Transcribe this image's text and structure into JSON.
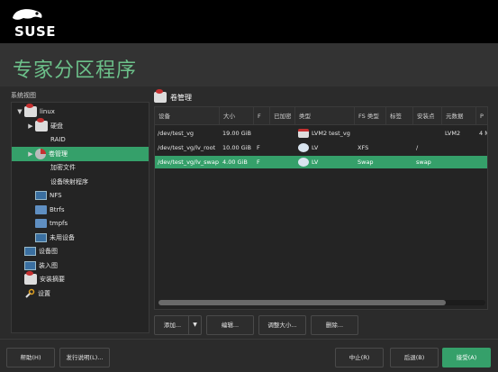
{
  "brand": {
    "logo_text": "SUSE"
  },
  "page": {
    "title": "专家分区程序"
  },
  "sidebar": {
    "label": "系统视图",
    "items": [
      {
        "label": "linux",
        "icon": "disk-icon",
        "indent": 0,
        "expander": "▼",
        "selected": false
      },
      {
        "label": "硬盘",
        "icon": "disk-icon",
        "indent": 1,
        "expander": "▶",
        "selected": false
      },
      {
        "label": "RAID",
        "icon": "",
        "indent": 1,
        "expander": "",
        "selected": false
      },
      {
        "label": "卷管理",
        "icon": "pie-icon",
        "indent": 1,
        "expander": "▶",
        "selected": true
      },
      {
        "label": "加密文件",
        "icon": "",
        "indent": 1,
        "expander": "",
        "selected": false
      },
      {
        "label": "设备映射程序",
        "icon": "",
        "indent": 1,
        "expander": "",
        "selected": false
      },
      {
        "label": "NFS",
        "icon": "screen-icon",
        "indent": 1,
        "expander": "",
        "selected": false
      },
      {
        "label": "Btrfs",
        "icon": "folder-icon",
        "indent": 1,
        "expander": "",
        "selected": false
      },
      {
        "label": "tmpfs",
        "icon": "folder-icon",
        "indent": 1,
        "expander": "",
        "selected": false
      },
      {
        "label": "未用设备",
        "icon": "screen-icon",
        "indent": 1,
        "expander": "",
        "selected": false
      },
      {
        "label": "设备图",
        "icon": "screen-icon",
        "indent": 0,
        "expander": "",
        "selected": false
      },
      {
        "label": "装入图",
        "icon": "screen-icon",
        "indent": 0,
        "expander": "",
        "selected": false
      },
      {
        "label": "安装摘要",
        "icon": "disk-icon",
        "indent": 0,
        "expander": "",
        "selected": false
      },
      {
        "label": "设置",
        "icon": "wrench-icon",
        "indent": 0,
        "expander": "",
        "selected": false
      }
    ]
  },
  "main": {
    "heading": "卷管理",
    "columns": [
      "设备",
      "大小",
      "F",
      "已加密",
      "类型",
      "FS 类型",
      "标签",
      "安装点",
      "元数据",
      "P"
    ],
    "rows": [
      {
        "device": "/dev/test_vg",
        "size": "19.00 GiB",
        "f": "",
        "enc": "",
        "type": "LVM2 test_vg",
        "fs": "",
        "label": "",
        "mount": "",
        "meta": "LVM2",
        "p": "4 M",
        "selected": false,
        "icon": "vg"
      },
      {
        "device": "/dev/test_vg/lv_root",
        "size": "10.00 GiB",
        "f": "F",
        "enc": "",
        "type": "LV",
        "fs": "XFS",
        "label": "",
        "mount": "/",
        "meta": "",
        "p": "",
        "selected": false,
        "icon": "lv"
      },
      {
        "device": "/dev/test_vg/lv_swap",
        "size": "4.00 GiB",
        "f": "F",
        "enc": "",
        "type": "LV",
        "fs": "Swap",
        "label": "",
        "mount": "swap",
        "meta": "",
        "p": "",
        "selected": true,
        "icon": "lv"
      }
    ],
    "scroll_fraction": 0.88
  },
  "actions": {
    "add": "添加...",
    "edit": "编辑...",
    "resize": "调整大小...",
    "delete": "删除..."
  },
  "footer": {
    "help": "帮助(H)",
    "release_notes": "发行说明(L)...",
    "abort": "中止(R)",
    "back": "后退(B)",
    "accept": "接受(A)"
  },
  "colors": {
    "accent": "#35a06a",
    "title": "#6cc08a",
    "background": "#2b2b2b"
  }
}
